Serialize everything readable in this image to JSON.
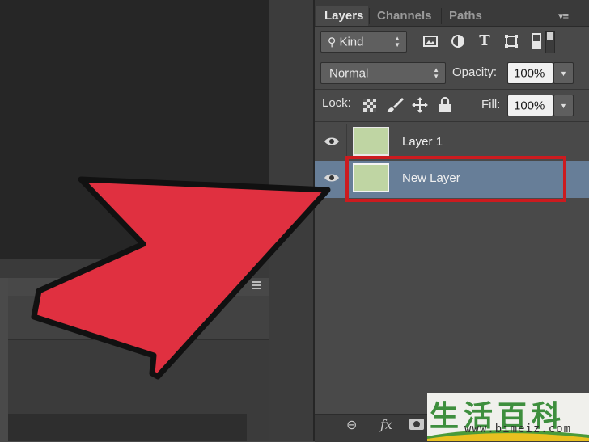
{
  "panel": {
    "tabs": [
      {
        "label": "Layers",
        "active": true
      },
      {
        "label": "Channels",
        "active": false
      },
      {
        "label": "Paths",
        "active": false
      }
    ],
    "menu_icon": "panel-menu-icon"
  },
  "filter": {
    "kind_label": "Kind",
    "filter_icons": [
      "image-filter-icon",
      "adjustment-filter-icon",
      "type-filter-icon",
      "shape-filter-icon",
      "smart-object-filter-icon"
    ]
  },
  "blend": {
    "mode": "Normal",
    "opacity_label": "Opacity:",
    "opacity_value": "100%"
  },
  "lock": {
    "label": "Lock:",
    "icons": [
      "lock-transparent-icon",
      "lock-paint-icon",
      "lock-position-icon",
      "lock-all-icon"
    ],
    "fill_label": "Fill:",
    "fill_value": "100%"
  },
  "layers": [
    {
      "name": "Layer 1",
      "selected": false,
      "thumb_color": "#bfd5a3"
    },
    {
      "name": "New Layer",
      "selected": true,
      "thumb_color": "#bfd5a3"
    }
  ],
  "footer": {
    "fx_label": "fx",
    "icons": [
      "link-layers-icon",
      "fx-icon",
      "mask-icon"
    ]
  },
  "watermark": {
    "chars": "生活百科",
    "url": "www.bimeiz.com"
  },
  "colors": {
    "selected_row": "#677e98",
    "highlight_box": "#cc1b1f",
    "arrow": "#e03040"
  }
}
